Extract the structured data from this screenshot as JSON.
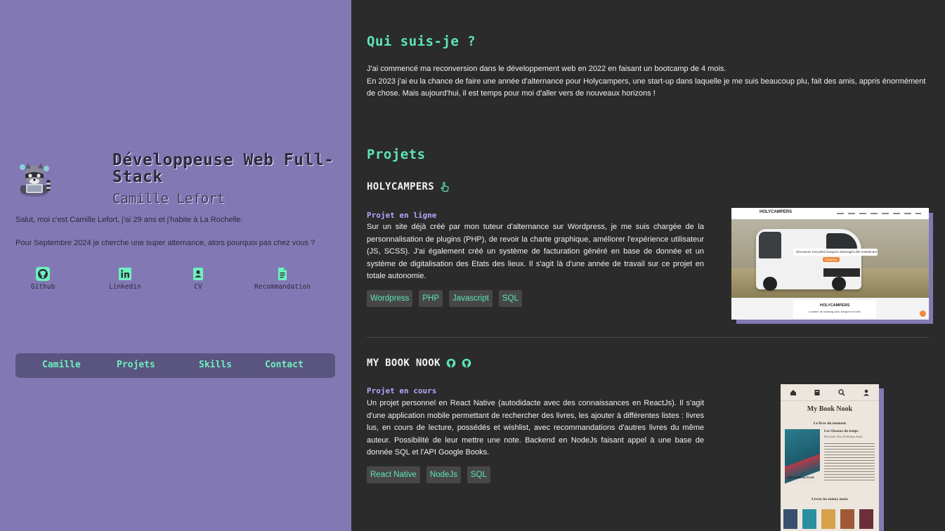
{
  "hero": {
    "title": "Développeuse Web Full-Stack",
    "name": "Camille Lefort"
  },
  "intro": {
    "line1": "Salut, moi c'est Camille Lefort, j'ai 29 ans et j'habite à La Rochelle.",
    "line2": "Pour Septembre 2024 je cherche une super alternance, alors pourquoi pas chez vous ?"
  },
  "links": [
    {
      "label": "Github",
      "icon": "github-icon"
    },
    {
      "label": "Linkedin",
      "icon": "linkedin-icon"
    },
    {
      "label": "CV",
      "icon": "cv-icon"
    },
    {
      "label": "Recommandation",
      "icon": "document-icon"
    }
  ],
  "nav": [
    "Camille",
    "Projets",
    "Skills",
    "Contact"
  ],
  "about": {
    "heading": "Qui suis-je ?",
    "p1": "J'ai commencé ma reconversion dans le développement web en 2022 en faisant un bootcamp de 4 mois.",
    "p2": "En 2023 j'ai eu la chance de faire une année d'alternance pour Holycampers, une start-up dans laquelle je me suis beaucoup plu, fait des amis, appris énormément de chose. Mais aujourd'hui, il est temps pour moi d'aller vers de nouveaux horizons !"
  },
  "projects_heading": "Projets",
  "projects": [
    {
      "title": "HOLYCAMPERS",
      "status": "Projet en ligne",
      "description": "Sur un site déjà créé par mon tuteur d'alternance sur Wordpress, je me suis chargée de la personnalisation de plugins (PHP), de revoir la charte graphique, améliorer l'expérience utilisateur (JS, SCSS). J'ai également créé un système de facturation généré en base de donnée et un système de digitalisation des Etats des lieux. Il s'agit là d'une année de travail sur ce projet en totale autonomie.",
      "tags": [
        "Wordpress",
        "PHP",
        "Javascript",
        "SQL"
      ],
      "shot": {
        "logo": "HOLYCAMPERS",
        "banner": "Découvrez nos petits fourgons aménagés dès maintenant !",
        "cta": "Réserver",
        "footer_logo": "HOLYCAMPERS",
        "footer_text": "Location de camping-cars, fourgons et vans"
      }
    },
    {
      "title": "MY BOOK NOOK",
      "status": "Projet en cours",
      "description": "Un projet personnel en React Native (autodidacte avec des connaissances en ReactJs). Il s'agit d'une application mobile permettant de rechercher des livres, les ajouter à différentes listes : livres lus, en cours de lecture, possédés et wishlist, avec recommandations d'autres livres du même auteur. Possibilité de leur mettre une note. Backend en NodeJs faisant appel à une base de donnée SQL et l'API Google Books.",
      "tags": [
        "React Native",
        "NodeJs",
        "SQL"
      ],
      "shot": {
        "app_title": "My Book Nook",
        "section": "Le livre du moment",
        "book_title": "Les Oiseaux du temps",
        "book_author": "Electronic Don El-Mohtar Amal",
        "book_stamp": "HIBOU MÉDIA PLUS",
        "section2": "Livres les mieux notés"
      }
    }
  ],
  "colors": {
    "left_bg": "#8279b4",
    "right_bg": "#2b2b2b",
    "accent_green": "#5de6b3",
    "accent_purple": "#b2a7ff",
    "nav_bg": "#5a5480"
  }
}
